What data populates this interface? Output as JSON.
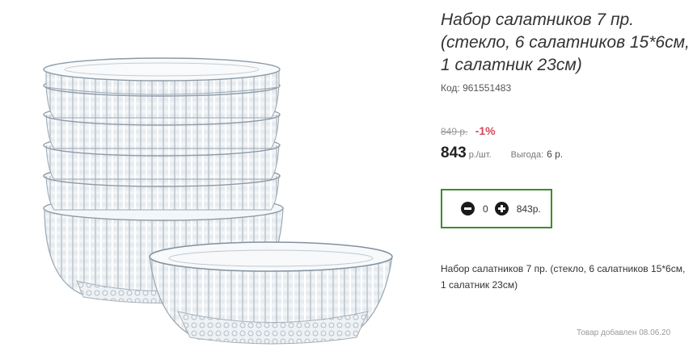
{
  "product": {
    "title": "Набор салатников 7 пр. (стекло, 6 салатников 15*6см, 1 салатник 23см)",
    "sku": "Код: 961551483",
    "old_price": "849 р.",
    "discount": "-1%",
    "price": "843",
    "price_unit": "р./шт.",
    "savings_label": "Выгода:",
    "savings_value": "6 р.",
    "description": "Набор салатников 7 пр. (стекло, 6 салатников 15*6см, 1 салатник 23см)",
    "added_note": "Товар добавлен 08.06.20"
  },
  "cart": {
    "quantity": "0",
    "total": "843р.",
    "minus_icon": "minus-circle-icon",
    "plus_icon": "plus-circle-icon",
    "border_color": "#3b8d2a"
  },
  "colors": {
    "discount": "#d44a5c",
    "accent_border": "#3b8d2a"
  }
}
